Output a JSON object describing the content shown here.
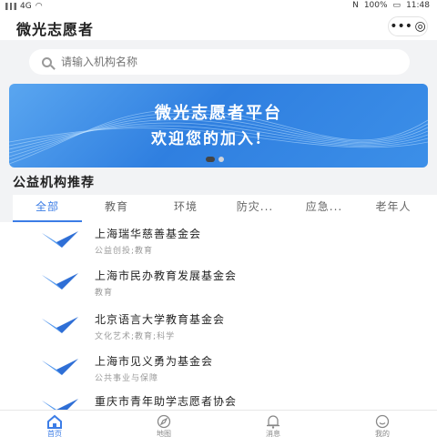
{
  "statusbar": {
    "network_text": "4G",
    "battery": "100%",
    "time": "11:48"
  },
  "header": {
    "title": "微光志愿者",
    "more_icon": "more-dots-icon",
    "close_icon": "target-close-icon"
  },
  "search": {
    "placeholder": "请输入机构名称"
  },
  "banner": {
    "line1": "微光志愿者平台",
    "line2": "欢迎您的加入!"
  },
  "section": {
    "title": "公益机构推荐"
  },
  "tabs": [
    {
      "label": "全部"
    },
    {
      "label": "教育"
    },
    {
      "label": "环境"
    },
    {
      "label": "防灾..."
    },
    {
      "label": "应急..."
    },
    {
      "label": "老年人"
    }
  ],
  "orgs": [
    {
      "name": "上海瑞华慈善基金会",
      "tags": "公益创投;教育"
    },
    {
      "name": "上海市民办教育发展基金会",
      "tags": "教育"
    },
    {
      "name": "北京语言大学教育基金会",
      "tags": "文化艺术;教育;科学"
    },
    {
      "name": "上海市见义勇为基金会",
      "tags": "公共事业与保障"
    },
    {
      "name": "重庆市青年助学志愿者协会",
      "tags": ""
    }
  ],
  "tabbar": [
    {
      "label": "首页",
      "icon": "home-icon"
    },
    {
      "label": "地图",
      "icon": "compass-icon"
    },
    {
      "label": "消息",
      "icon": "bell-icon"
    },
    {
      "label": "我的",
      "icon": "profile-icon"
    }
  ],
  "colors": {
    "accent": "#3c7de6",
    "banner": "#2f7fe0"
  }
}
